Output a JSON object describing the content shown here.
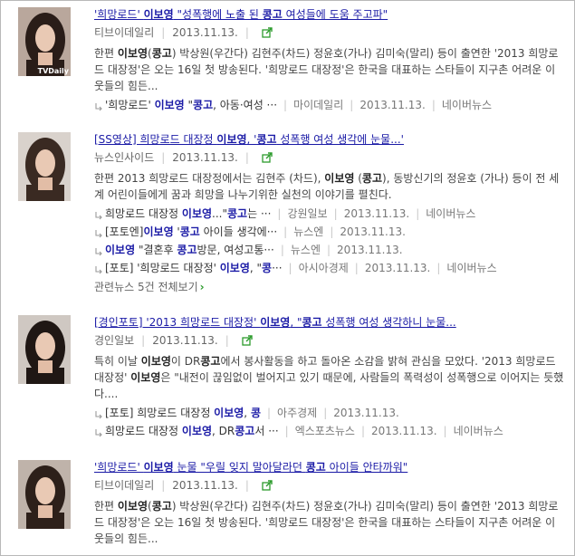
{
  "articles": [
    {
      "title_parts": [
        "'희망로드' ",
        "이보영",
        " \"성폭행에 노출 된 ",
        "콩고",
        " 여성들에 도움 주고파\""
      ],
      "source": "티브이데일리",
      "date": "2013.11.13.",
      "thumb_label": "TVDaily",
      "snippet_parts": [
        "한편 ",
        "이보영",
        "(",
        "콩고",
        ") 박상원(우간다) 김현주(차드) 정윤호(가나) 김미숙(말리) 등이 출연한 '2013 희망로드 대장정'은 오는 16일 첫 방송된다. '희망로드 대장정'은 한국을 대표하는 스타들이 지구촌 어려운 이웃들의 힘든..."
      ],
      "related": [
        {
          "parts": [
            "'희망로드' ",
            "이보영",
            " \"",
            "콩고",
            ", 아동·여성 ···"
          ],
          "source": "마이데일리",
          "date": "2013.11.13.",
          "extra": "네이버뉴스"
        }
      ]
    },
    {
      "title_parts": [
        "[SS영상] 희망로드 대장정 ",
        "이보영",
        ", '",
        "콩고",
        " 성폭행 여성 생각에 눈물...'"
      ],
      "source": "뉴스인사이드",
      "date": "2013.11.13.",
      "thumb_label": "",
      "snippet_parts": [
        "한편 2013 희망로드 대장정에서는 김현주 (차드), ",
        "이보영",
        " (",
        "콩고",
        "), 동방신기의 정윤호 (가나) 등이 전 세계 어린이들에게 꿈과 희망을 나누기위한 실천의 이야기를 펼친다."
      ],
      "related": [
        {
          "parts": [
            "희망로드 대장정 ",
            "이보영",
            "...\"",
            "콩고",
            "는 ···"
          ],
          "source": "강원일보",
          "date": "2013.11.13.",
          "extra": "네이버뉴스"
        },
        {
          "parts": [
            "[포토엔]",
            "이보영",
            " '",
            "콩고",
            " 아이들 생각에···"
          ],
          "source": "뉴스엔",
          "date": "2013.11.13.",
          "extra": ""
        },
        {
          "parts": [
            "",
            "이보영",
            " \"결혼후 ",
            "콩고",
            "방문, 여성고통···"
          ],
          "source": "뉴스엔",
          "date": "2013.11.13.",
          "extra": ""
        },
        {
          "parts": [
            "[포토] '희망로드 대장정' ",
            "이보영",
            ", \"",
            "콩",
            "···"
          ],
          "source": "아시아경제",
          "date": "2013.11.13.",
          "extra": "네이버뉴스"
        }
      ],
      "more": "관련뉴스 5건 전체보기"
    },
    {
      "title_parts": [
        "[경인포토] '2013 희망로드 대장정' ",
        "이보영",
        ", \"",
        "콩고",
        " 성폭행 여성 생각하니 눈물..."
      ],
      "source": "경인일보",
      "date": "2013.11.13.",
      "thumb_label": "",
      "snippet_parts": [
        "특히 이날 ",
        "이보영",
        "이 DR",
        "콩고",
        "에서 봉사활동을 하고 돌아온 소감을 밝혀 관심을 모았다. '2013 희망로드 대장정' ",
        "이보영",
        "은 \"내전이 끊임없이 벌어지고 있기 때문에, 사람들의 폭력성이 성폭행으로 이어지는 듯했다...."
      ],
      "related": [
        {
          "parts": [
            "[포토] 희망로드 대장정 ",
            "이보영",
            ", ",
            "콩",
            ""
          ],
          "source": "아주경제",
          "date": "2013.11.13.",
          "extra": ""
        },
        {
          "parts": [
            "희망로드 대장정 ",
            "이보영",
            ", DR",
            "콩고",
            "서 ···"
          ],
          "source": "엑스포츠뉴스",
          "date": "2013.11.13.",
          "extra": "네이버뉴스"
        }
      ]
    },
    {
      "title_parts": [
        "'희망로드' ",
        "이보영",
        " 눈물 \"우릴 잊지 말아달라던 ",
        "콩고",
        " 아이들 안타까워\""
      ],
      "source": "티브이데일리",
      "date": "2013.11.13.",
      "thumb_label": "",
      "snippet_parts": [
        "한편 ",
        "이보영",
        "(",
        "콩고",
        ") 박상원(우간다) 김현주(차드) 정윤호(가나) 김미숙(말리) 등이 출연한 '2013 희망로드 대장정'은 오는 16일 첫 방송된다. '희망로드 대장정'은 한국을 대표하는 스타들이 지구촌 어려운 이웃들의 힘든..."
      ],
      "related": []
    }
  ],
  "icons": {
    "share": "share-arrow-icon",
    "related": "corner-arrow-icon"
  },
  "colors": {
    "link": "#1a1aa6",
    "share_green": "#2c9b2c",
    "separator": "#c8c8c8"
  }
}
